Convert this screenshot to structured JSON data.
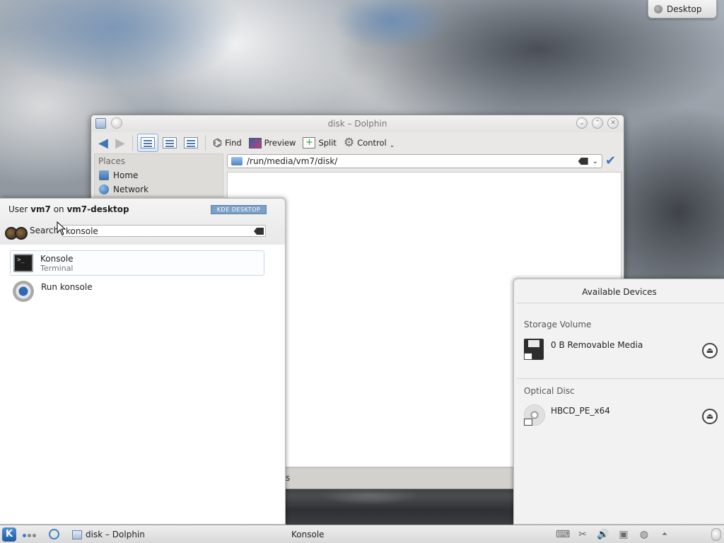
{
  "desktop": {
    "toolbox_label": "Desktop"
  },
  "dolphin": {
    "title": "disk – Dolphin",
    "toolbar": {
      "find": "Find",
      "preview": "Preview",
      "split": "Split",
      "control": "Control"
    },
    "places": {
      "title": "Places",
      "items": [
        {
          "label": "Home",
          "icon": "home-icon"
        },
        {
          "label": "Network",
          "icon": "network-icon"
        }
      ]
    },
    "location": "/run/media/vm7/disk/",
    "status_fragment": "s"
  },
  "launcher": {
    "user_prefix": "User",
    "user_name": "vm7",
    "user_on": "on",
    "host_name": "vm7-desktop",
    "badge": "KDE DESKTOP",
    "search_label": "Search",
    "search_value": "konsole",
    "results": [
      {
        "name": "Konsole",
        "subtitle": "Terminal",
        "icon": "terminal-icon",
        "selected": true
      },
      {
        "name": "Run konsole",
        "subtitle": "",
        "icon": "run-command-icon",
        "selected": false
      }
    ]
  },
  "devices": {
    "title": "Available Devices",
    "groups": [
      {
        "category": "Storage Volume",
        "device": "0 B Removable Media",
        "icon": "floppy-icon"
      },
      {
        "category": "Optical Disc",
        "device": "HBCD_PE_x64",
        "icon": "optical-disc-icon"
      }
    ]
  },
  "taskbar": {
    "tasks": [
      {
        "label": "disk – Dolphin"
      },
      {
        "label": "Konsole"
      }
    ]
  },
  "colors": {
    "accent": "#3f76b6",
    "panel": "#e9e8e6",
    "badge": "#7da0c8"
  }
}
